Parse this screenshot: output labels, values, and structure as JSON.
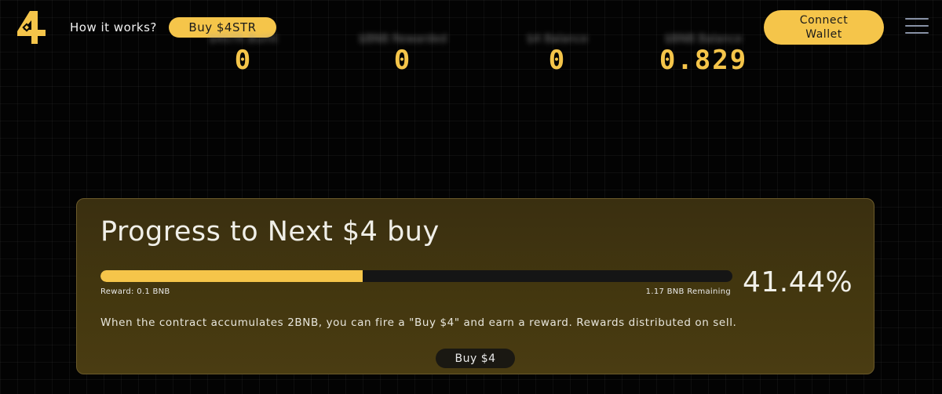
{
  "header": {
    "how_it_works": "How it works?",
    "buy_token_label": "Buy $4STR",
    "connect_wallet_label": "Connect\nWallet"
  },
  "stats": [
    {
      "label": "$4STR Burnt",
      "value": "0"
    },
    {
      "label": "$BNB Rewarded",
      "value": "0"
    },
    {
      "label": "$4 Balance",
      "value": "0"
    },
    {
      "label": "$BNB Balance",
      "value": "0.829"
    }
  ],
  "progress_card": {
    "title": "Progress to Next $4 buy",
    "progress_fraction": 0.4144,
    "reward_text": "Reward: 0.1 BNB",
    "remaining_text": "1.17 BNB Remaining",
    "percent_text": "41.44%",
    "description": "When the contract accumulates 2BNB, you can fire a \"Buy $4\" and earn a reward. Rewards distributed on sell.",
    "buy_button_label": "Buy $4"
  },
  "colors": {
    "accent": "#f5c54a",
    "background": "#030303",
    "card": "#43370f"
  }
}
